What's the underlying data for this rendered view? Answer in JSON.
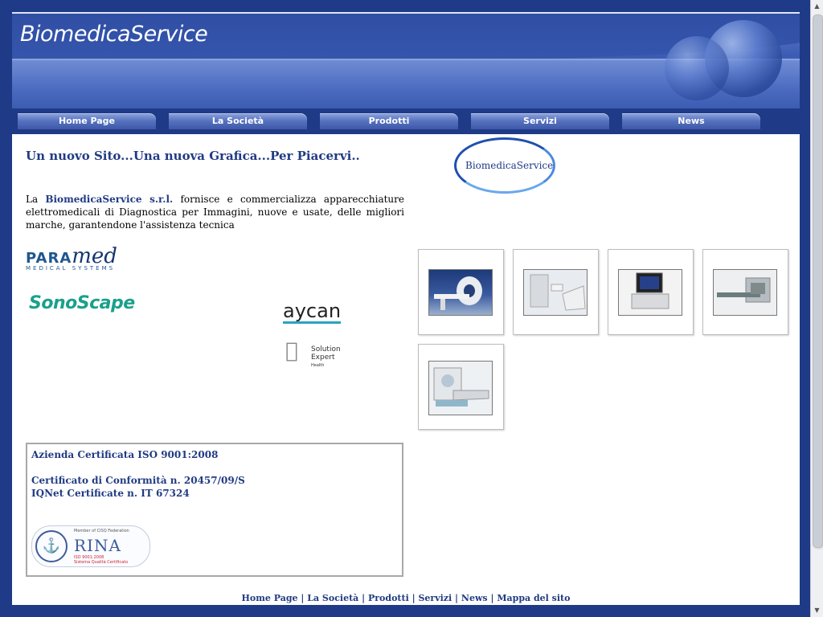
{
  "banner": {
    "title": "BiomedicaService"
  },
  "nav": {
    "items": [
      {
        "label": "Home Page"
      },
      {
        "label": "La Società"
      },
      {
        "label": "Prodotti"
      },
      {
        "label": "Servizi"
      },
      {
        "label": "News"
      }
    ]
  },
  "main": {
    "headline": "Un nuovo Sito...Una nuova Grafica...Per Piacervi..",
    "intro_prefix": "La ",
    "intro_company": "BiomedicaService s.r.l.",
    "intro_text": " fornisce e commercializza apparecchiature elettromedicali di Diagnostica per Immagini, nuove e usate, delle migliori marche, garantendone l'assistenza tecnica"
  },
  "logos": {
    "company": "BiomedicaService",
    "paramed_big": "PARA",
    "paramed_script": "med",
    "paramed_sub": "MEDICAL SYSTEMS",
    "sonoscape": "SonoScape",
    "aycan": "aycan",
    "apple_line1": "Solution",
    "apple_line2": "Expert",
    "apple_line3": "Health"
  },
  "products": [
    {
      "icon": "ct-scanner-icon"
    },
    {
      "icon": "xray-unit-icon"
    },
    {
      "icon": "ultrasound-icon"
    },
    {
      "icon": "mri-table-icon"
    },
    {
      "icon": "mri-scanner-icon"
    }
  ],
  "cert": {
    "line1": "Azienda Certificata ISO 9001:2008",
    "line2": "Certificato di Conformità n. 20457/09/S",
    "line3": "IQNet Certificate n. IT 67324",
    "rina_name": "RINA",
    "rina_member": "Member of CISQ Federation",
    "rina_iso": "ISO 9001:2008",
    "rina_sistema": "Sistema Qualità Certificato"
  },
  "footer": {
    "links": [
      "Home Page",
      "La Società",
      "Prodotti",
      "Servizi",
      "News",
      "Mappa del sito"
    ]
  }
}
